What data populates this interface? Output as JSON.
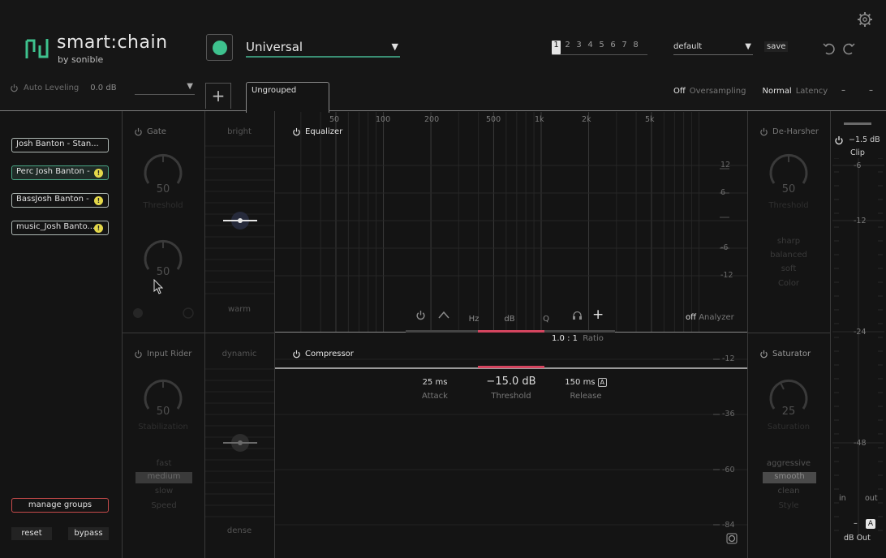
{
  "app": {
    "logo_text": "smart:chain",
    "logo_sub": "by sonible",
    "preset_name": "Universal",
    "slots": [
      "1",
      "2",
      "3",
      "4",
      "5",
      "6",
      "7",
      "8"
    ],
    "active_slot": "1",
    "default_label": "default",
    "save_label": "save"
  },
  "topbar": {
    "auto_leveling_label": "Auto Leveling",
    "auto_leveling_value": "0.0 dB",
    "tab_label": "Ungrouped",
    "oversampling_state": "Off",
    "oversampling_label": "Oversampling",
    "latency_state": "Normal",
    "latency_label": "Latency",
    "dash1": "–",
    "dash2": "–"
  },
  "groups": {
    "items": [
      {
        "label": "Josh Banton - Stan...",
        "warning": false
      },
      {
        "label": "Perc Josh Banton -",
        "warning": true
      },
      {
        "label": "BassJosh Banton -",
        "warning": true
      },
      {
        "label": "music_Josh Banto...",
        "warning": true
      }
    ],
    "warning_glyph": "!",
    "manage_label": "manage groups",
    "reset_label": "reset",
    "bypass_label": "bypass"
  },
  "gate": {
    "title": "Gate",
    "knob1_value": "50",
    "knob1_label": "Threshold",
    "knob2_value": "50"
  },
  "input_rider": {
    "title": "Input Rider",
    "knob_value": "50",
    "knob_label": "Stabilization",
    "options": [
      "fast",
      "medium",
      "slow"
    ],
    "selected": "medium",
    "speed_label": "Speed"
  },
  "tone_strip": {
    "top": "bright",
    "bottom": "warm",
    "top2": "dynamic",
    "bottom2": "dense"
  },
  "equalizer": {
    "title": "Equalizer",
    "freq_labels": [
      "50",
      "100",
      "200",
      "500",
      "1k",
      "2k",
      "5k"
    ],
    "db_labels": [
      "12",
      "6",
      "-6",
      "-12"
    ],
    "ctrl_hz": "Hz",
    "ctrl_db": "dB",
    "ctrl_q": "Q",
    "add_glyph": "+",
    "analyzer_state": "off",
    "analyzer_label": "Analyzer"
  },
  "compressor": {
    "title": "Compressor",
    "ratio_value": "1.0 : 1",
    "ratio_label": "Ratio",
    "attack_value": "25 ms",
    "attack_label": "Attack",
    "threshold_value": "−15.0 dB",
    "threshold_label": "Threshold",
    "release_value": "150 ms",
    "release_label": "Release",
    "auto_glyph": "A",
    "db_labels": [
      "-12",
      "-36",
      "-60",
      "-84"
    ]
  },
  "deharsher": {
    "title": "De-Harsher",
    "knob_value": "50",
    "knob_label": "Threshold",
    "options": [
      "sharp",
      "balanced",
      "soft"
    ],
    "mode_label": "Color"
  },
  "saturator": {
    "title": "Saturator",
    "knob_value": "25",
    "knob_label": "Saturation",
    "options": [
      "aggressive",
      "smooth",
      "clean"
    ],
    "selected": "smooth",
    "style_label": "Style"
  },
  "meter": {
    "clip_value": "−1.5 dB",
    "clip_label": "Clip",
    "db_labels": [
      "-6",
      "-12",
      "-24",
      "-48"
    ],
    "in_label": "in",
    "out_label": "out",
    "auto_glyph": "A",
    "dbout_label": "dB Out",
    "dash": "–"
  },
  "colors": {
    "accent": "#3ec28e",
    "threshold_bar": "#d4455f",
    "background": "#141414"
  }
}
